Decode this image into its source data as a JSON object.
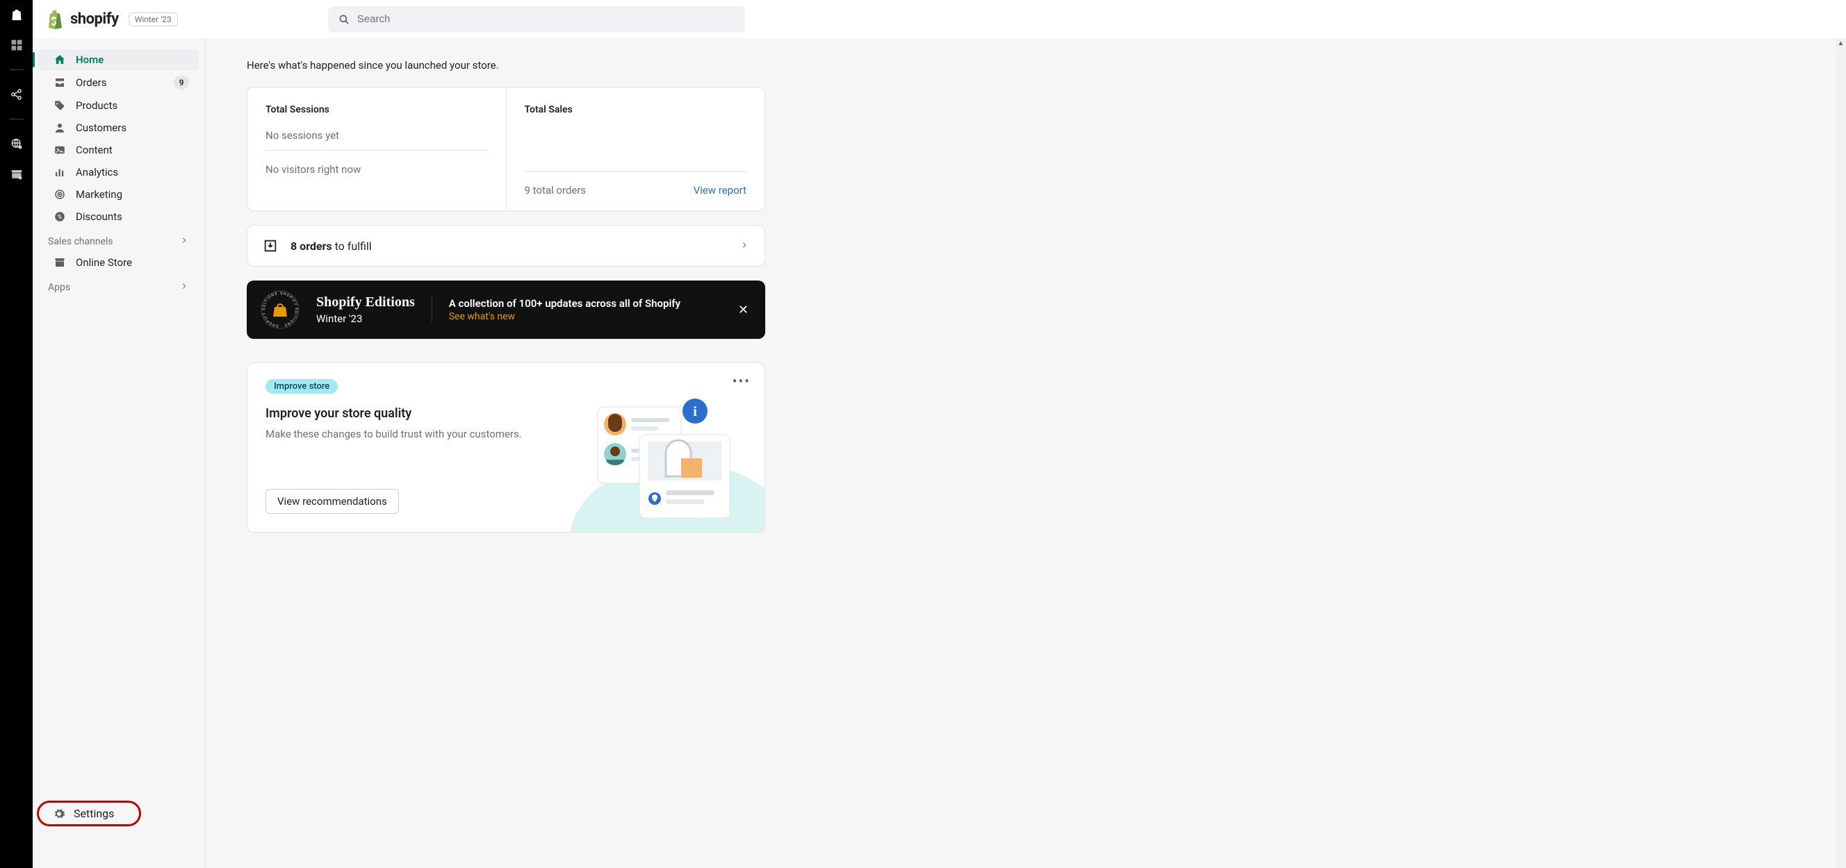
{
  "brand": {
    "word": "shopify",
    "chip": "Winter '23"
  },
  "search": {
    "placeholder": "Search"
  },
  "sidebar": {
    "items": [
      {
        "label": "Home"
      },
      {
        "label": "Orders",
        "badge": "9"
      },
      {
        "label": "Products"
      },
      {
        "label": "Customers"
      },
      {
        "label": "Content"
      },
      {
        "label": "Analytics"
      },
      {
        "label": "Marketing"
      },
      {
        "label": "Discounts"
      }
    ],
    "channels_label": "Sales channels",
    "online_store": "Online Store",
    "apps_label": "Apps",
    "settings": "Settings"
  },
  "intro": "Here's what's happened since you launched your store.",
  "stats": {
    "sessions_title": "Total Sessions",
    "sessions_line1": "No sessions yet",
    "sessions_line2": "No visitors right now",
    "sales_title": "Total Sales",
    "sales_line": "9 total orders",
    "sales_link": "View report"
  },
  "fulfill": {
    "count": "8 orders",
    "rest": " to fulfill"
  },
  "editions": {
    "title": "Shopify Editions",
    "sub": "Winter '23",
    "line": "A collection of 100+ updates across all of Shopify",
    "link": "See what's new"
  },
  "improve": {
    "pill": "Improve store",
    "title": "Improve your store quality",
    "desc": "Make these changes to build trust with your customers.",
    "button": "View recommendations"
  }
}
